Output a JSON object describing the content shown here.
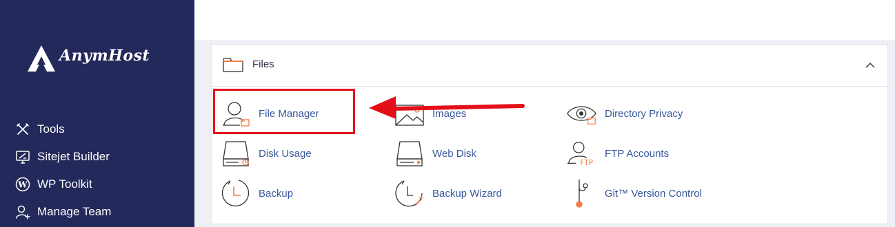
{
  "brand": {
    "name": "AnymHost"
  },
  "sidebar": {
    "items": [
      {
        "label": "Tools",
        "icon": "tools-icon"
      },
      {
        "label": "Sitejet Builder",
        "icon": "sitejet-icon"
      },
      {
        "label": "WP Toolkit",
        "icon": "wordpress-icon"
      },
      {
        "label": "Manage Team",
        "icon": "manage-team-icon"
      }
    ]
  },
  "files": {
    "title": "Files",
    "items": [
      {
        "label": "File Manager",
        "icon": "file-manager-icon"
      },
      {
        "label": "Images",
        "icon": "images-icon"
      },
      {
        "label": "Directory Privacy",
        "icon": "directory-privacy-icon"
      },
      {
        "label": "Disk Usage",
        "icon": "disk-usage-icon"
      },
      {
        "label": "Web Disk",
        "icon": "web-disk-icon"
      },
      {
        "label": "FTP Accounts",
        "icon": "ftp-accounts-icon"
      },
      {
        "label": "Backup",
        "icon": "backup-icon"
      },
      {
        "label": "Backup Wizard",
        "icon": "backup-wizard-icon"
      },
      {
        "label": "Git™ Version Control",
        "icon": "git-icon"
      }
    ],
    "ftp_icon_text": "FTP"
  },
  "colors": {
    "sidebar_bg": "#23295a",
    "accent_orange": "#f07c45",
    "link_blue": "#37589b",
    "highlight_red": "#e3101a"
  }
}
